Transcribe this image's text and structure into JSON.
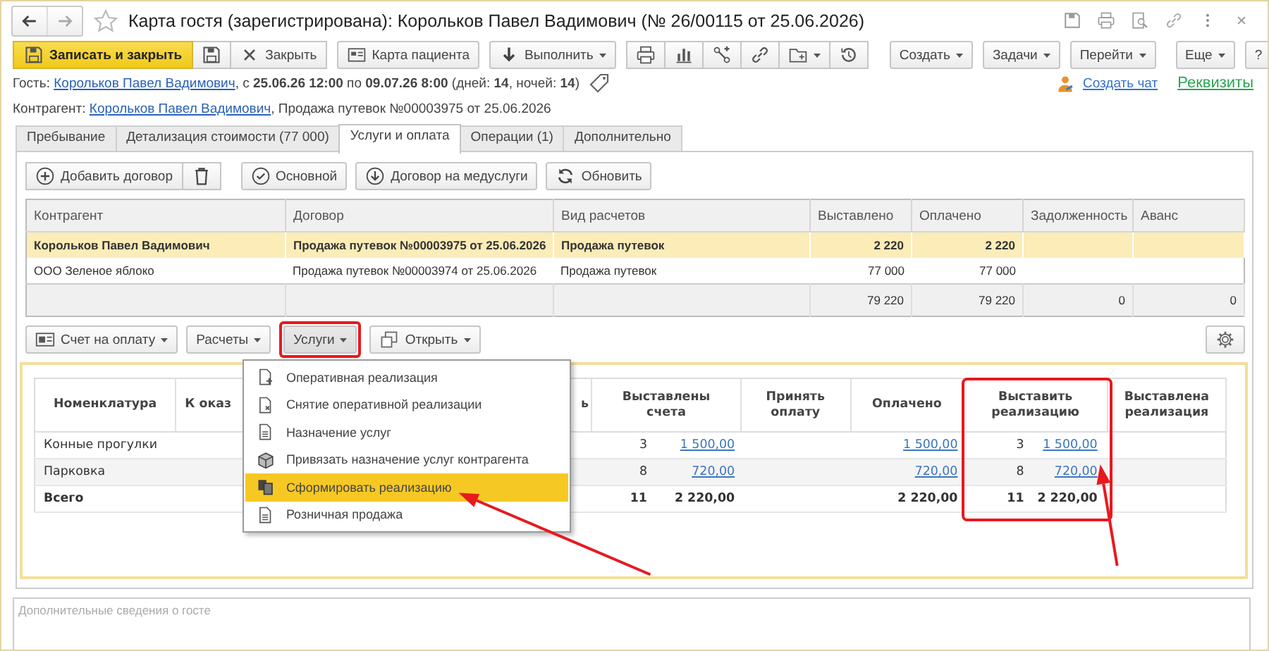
{
  "window": {
    "title": "Карта гостя (зарегистрирована): Корольков Павел Вадимович (№ 26/00115 от 25.06.2026)"
  },
  "toolbar": {
    "save_close": "Записать и закрыть",
    "close": "Закрыть",
    "patient_card": "Карта пациента",
    "execute": "Выполнить",
    "create": "Создать",
    "tasks": "Задачи",
    "go_to": "Перейти",
    "more": "Еще",
    "help": "?"
  },
  "guest": {
    "label": "Гость:",
    "link": "Корольков Павел Вадимович",
    "text": ", с **25.06.26 12:00** по **09.07.26 8:00** (дней: **14**, ночей: **14**)"
  },
  "links": {
    "chat": "Создать чат",
    "details": "Реквизиты"
  },
  "counterparty": {
    "label": "Контрагент:",
    "link": "Корольков Павел Вадимович",
    "text": ", Продажа путевок №00003975 от 25.06.2026"
  },
  "tabs": [
    {
      "label": "Пребывание",
      "selected": false
    },
    {
      "label": "Детализация стоимости (77 000)",
      "selected": false
    },
    {
      "label": "Услуги и оплата",
      "selected": true
    },
    {
      "label": "Операции (1)",
      "selected": false
    },
    {
      "label": "Дополнительно",
      "selected": false
    }
  ],
  "contracts_toolbar": {
    "add": "Добавить договор",
    "main": "Основной",
    "medical": "Договор на медуслуги",
    "refresh": "Обновить"
  },
  "contracts": {
    "columns": [
      "Контрагент",
      "Договор",
      "Вид расчетов",
      "Выставлено",
      "Оплачено",
      "Задолженность",
      "Аванс"
    ],
    "rows": [
      {
        "selected": true,
        "counterparty": "Корольков Павел Вадимович",
        "contract": "Продажа путевок №00003975 от 25.06.2026",
        "settlement": "Продажа путевок",
        "issued": "2 220",
        "paid": "2 220"
      },
      {
        "selected": false,
        "counterparty": "ООО Зеленое яблоко",
        "contract": "Продажа путевок №00003974 от 25.06.2026",
        "settlement": "Продажа путевок",
        "issued": "77 000",
        "paid": "77 000"
      }
    ],
    "footer": {
      "issued": "79 220",
      "paid": "79 220",
      "debt": "0",
      "advance": "0"
    }
  },
  "services_toolbar": {
    "invoice": "Счет на оплату",
    "settlements": "Расчеты",
    "services": "Услуги",
    "services_highlighted": true,
    "open": "Открыть"
  },
  "services_menu": {
    "items": [
      {
        "label": "Оперативная реализация",
        "selected": false
      },
      {
        "label": "Снятие оперативной реализации",
        "selected": false
      },
      {
        "label": "Назначение услуг",
        "selected": false
      },
      {
        "label": "Привязать назначение услуг контрагента",
        "selected": false
      },
      {
        "label": "Сформировать реализацию",
        "selected": true
      },
      {
        "label": "Розничная продажа",
        "selected": false
      }
    ]
  },
  "services": {
    "headers": {
      "item": "Номенклатура",
      "col_2": "К оказ",
      "col_3": "ь",
      "invoiced": "Выставлены счета",
      "accept": "Принять оплату",
      "paid": "Оплачено",
      "to_realize": "Выставить реализацию",
      "realized": "Выставлена реализация"
    },
    "to_realize_highlighted": true,
    "rows": [
      {
        "kind": "item",
        "item": "Конные прогулки",
        "invoiced_qty": "3",
        "invoiced_sum": "1 500,00",
        "paid": "1 500,00",
        "to_realize_qty": "3",
        "to_realize_sum": "1 500,00"
      },
      {
        "kind": "item",
        "item": "Парковка",
        "invoiced_qty": "8",
        "invoiced_sum": "720,00",
        "paid": "720,00",
        "to_realize_qty": "8",
        "to_realize_sum": "720,00"
      },
      {
        "kind": "total",
        "item": "Всего",
        "invoiced_qty": "11",
        "invoiced_sum": "2 220,00",
        "paid": "2 220,00",
        "to_realize_qty": "11",
        "to_realize_sum": "2 220,00"
      }
    ]
  },
  "notes": {
    "placeholder": "Дополнительные сведения о госте"
  }
}
